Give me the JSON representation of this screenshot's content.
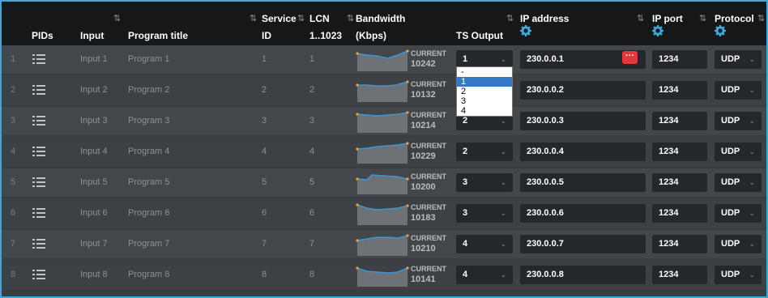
{
  "colors": {
    "accent": "#41a6dc",
    "header_bg": "#161719",
    "row_even": "#43464b",
    "row_odd": "#3d4045",
    "field_bg": "#24272b",
    "danger": "#e23a3a",
    "sparkline": "#3a96d6"
  },
  "header": {
    "pids": "PIDs",
    "input": "Input",
    "program_title": "Program title",
    "service_id_1": "Service",
    "service_id_2": "ID",
    "lcn_1": "LCN",
    "lcn_2": "1..1023",
    "bandwidth_1": "Bandwidth",
    "bandwidth_2": "(Kbps)",
    "ts_output": "TS Output",
    "ip_address": "IP address",
    "ip_port": "IP port",
    "protocol": "Protocol",
    "sort_icon": "sort-icon",
    "settings_icon": "gear-icon"
  },
  "rows": [
    {
      "index": "1",
      "input": "Input 1",
      "program": "Program 1",
      "service_id": "1",
      "lcn": "1",
      "bw_label": "CURRENT",
      "bw_value": "10242",
      "ts_output": "1",
      "ip_address": "230.0.0.1",
      "ip_port": "1234",
      "protocol": "UDP"
    },
    {
      "index": "2",
      "input": "Input 2",
      "program": "Program 2",
      "service_id": "2",
      "lcn": "2",
      "bw_label": "CURRENT",
      "bw_value": "10132",
      "ts_output": "",
      "ip_address": "230.0.0.2",
      "ip_port": "1234",
      "protocol": "UDP"
    },
    {
      "index": "3",
      "input": "Input 3",
      "program": "Program 3",
      "service_id": "3",
      "lcn": "3",
      "bw_label": "CURRENT",
      "bw_value": "10214",
      "ts_output": "2",
      "ip_address": "230.0.0.3",
      "ip_port": "1234",
      "protocol": "UDP"
    },
    {
      "index": "4",
      "input": "Input 4",
      "program": "Program 4",
      "service_id": "4",
      "lcn": "4",
      "bw_label": "CURRENT",
      "bw_value": "10229",
      "ts_output": "2",
      "ip_address": "230.0.0.4",
      "ip_port": "1234",
      "protocol": "UDP"
    },
    {
      "index": "5",
      "input": "Input 5",
      "program": "Program 5",
      "service_id": "5",
      "lcn": "5",
      "bw_label": "CURRENT",
      "bw_value": "10200",
      "ts_output": "3",
      "ip_address": "230.0.0.5",
      "ip_port": "1234",
      "protocol": "UDP"
    },
    {
      "index": "6",
      "input": "Input 6",
      "program": "Program 6",
      "service_id": "6",
      "lcn": "6",
      "bw_label": "CURRENT",
      "bw_value": "10183",
      "ts_output": "3",
      "ip_address": "230.0.0.6",
      "ip_port": "1234",
      "protocol": "UDP"
    },
    {
      "index": "7",
      "input": "Input 7",
      "program": "Program 7",
      "service_id": "7",
      "lcn": "7",
      "bw_label": "CURRENT",
      "bw_value": "10210",
      "ts_output": "4",
      "ip_address": "230.0.0.7",
      "ip_port": "1234",
      "protocol": "UDP"
    },
    {
      "index": "8",
      "input": "Input 8",
      "program": "Program 8",
      "service_id": "8",
      "lcn": "8",
      "bw_label": "CURRENT",
      "bw_value": "10141",
      "ts_output": "4",
      "ip_address": "230.0.0.8",
      "ip_port": "1234",
      "protocol": "UDP"
    }
  ],
  "row_icons": {
    "pids": "list-icon",
    "more": "more-icon",
    "chevron": "chevron-down-icon"
  },
  "ts_dropdown": {
    "options": [
      "-",
      "1",
      "2",
      "3",
      "4"
    ],
    "selected": "1"
  }
}
